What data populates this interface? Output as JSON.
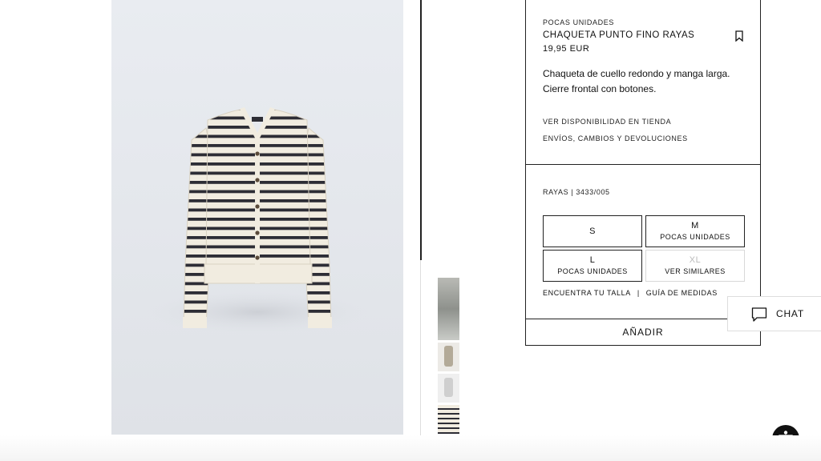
{
  "product": {
    "stock_label": "POCAS UNIDADES",
    "title": "CHAQUETA PUNTO FINO RAYAS",
    "price": "19,95 EUR",
    "description": "Chaqueta de cuello redondo y manga larga. Cierre frontal con botones.",
    "link_store": "VER DISPONIBILIDAD EN TIENDA",
    "link_shipping": "ENVÍOS, CAMBIOS Y DEVOLUCIONES",
    "color_ref": "RAYAS | 3433/005"
  },
  "sizes": [
    {
      "size": "S",
      "note": ""
    },
    {
      "size": "M",
      "note": "POCAS UNIDADES"
    },
    {
      "size": "L",
      "note": "POCAS UNIDADES"
    },
    {
      "size": "XL",
      "note": "VER SIMILARES"
    }
  ],
  "size_links": {
    "find_size": "ENCUENTRA TU TALLA",
    "separator": "|",
    "size_guide": "GUÍA DE MEDIDAS"
  },
  "add_button": "AÑADIR",
  "chat_label": "CHAT",
  "icons": {
    "bookmark": "bookmark-icon",
    "chat": "chat-icon",
    "accessibility": "accessibility-icon"
  },
  "colors": {
    "cream": "#f1ece0",
    "stripe": "#2d2d35",
    "border": "#222222"
  }
}
